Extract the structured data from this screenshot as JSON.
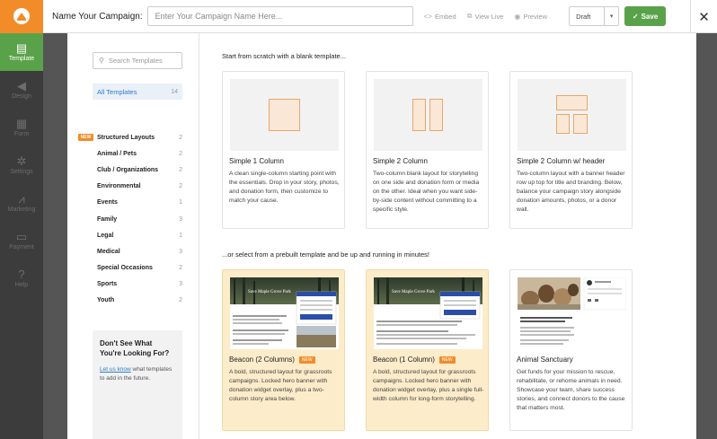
{
  "topbar": {
    "campaign_label": "Name Your Campaign:",
    "campaign_placeholder": "Enter Your Campaign Name Here...",
    "embed": "Embed",
    "view_live": "View Live",
    "preview": "Preview",
    "status": "Draft",
    "save": "Save"
  },
  "sidebar": {
    "items": [
      {
        "label": "Template",
        "icon": "template-icon"
      },
      {
        "label": "Design",
        "icon": "megaphone-icon"
      },
      {
        "label": "Form",
        "icon": "form-icon"
      },
      {
        "label": "Settings",
        "icon": "gears-icon"
      },
      {
        "label": "Marketing",
        "icon": "chart-icon"
      },
      {
        "label": "Payment",
        "icon": "card-icon"
      },
      {
        "label": "Help",
        "icon": "help-icon"
      }
    ]
  },
  "left": {
    "search_placeholder": "Search Templates",
    "all_templates": "All Templates",
    "all_count": "14",
    "new_badge": "NEW",
    "categories": [
      {
        "name": "Structured Layouts",
        "count": "2"
      },
      {
        "name": "Animal / Pets",
        "count": "2"
      },
      {
        "name": "Club / Organizations",
        "count": "2"
      },
      {
        "name": "Environmental",
        "count": "2"
      },
      {
        "name": "Events",
        "count": "1"
      },
      {
        "name": "Family",
        "count": "3"
      },
      {
        "name": "Legal",
        "count": "1"
      },
      {
        "name": "Medical",
        "count": "3"
      },
      {
        "name": "Special Occasions",
        "count": "2"
      },
      {
        "name": "Sports",
        "count": "3"
      },
      {
        "name": "Youth",
        "count": "2"
      }
    ],
    "dont_see_title": "Don't See What You're Looking For?",
    "dont_see_link": "Let us know",
    "dont_see_text": " what templates to add in the future."
  },
  "main": {
    "blank_heading": "Start from scratch with a blank template...",
    "prebuilt_heading": "...or select from a prebuilt template and be up and running in minutes!",
    "blank": [
      {
        "title": "Simple 1 Column",
        "desc": "A clean single-column starting point with the essentials. Drop in your story, photos, and donation form, then customize to match your cause."
      },
      {
        "title": "Simple 2 Column",
        "desc": "Two-column blank layout for storytelling on one side and donation form or media on the other. Ideal when you want side-by-side content without committing to a specific style."
      },
      {
        "title": "Simple 2 Column w/ header",
        "desc": "Two-column layout with a banner header row up top for title and branding. Below, balance your campaign story alongside donation amounts, photos, or a donor wall."
      }
    ],
    "prebuilt": [
      {
        "title": "Beacon (2 Columns)",
        "badge": "NEW",
        "banner": "Save Maple Grove Park",
        "desc": "A bold, structured layout for grassroots campaigns. Locked hero banner with donation widget overlay, plus a two-column story area below."
      },
      {
        "title": "Beacon (1 Column)",
        "badge": "NEW",
        "banner": "Save Maple Grove Park",
        "desc": "A bold, structured layout for grassroots campaigns. Locked hero banner with donation widget overlay, plus a single full-width column for long-form storytelling."
      },
      {
        "title": "Animal Sanctuary",
        "desc": "Get funds for your mission to rescue, rehabilitate, or rehome animals in need. Showcase your team, share success stories, and connect donors to the cause that matters most."
      }
    ]
  },
  "colors": {
    "accent_green": "#5aa24a",
    "brand_orange": "#f28c28",
    "sidebar_bg": "#3c3c3c",
    "link_blue": "#2d7ac8",
    "highlight_card": "#fdecca"
  }
}
